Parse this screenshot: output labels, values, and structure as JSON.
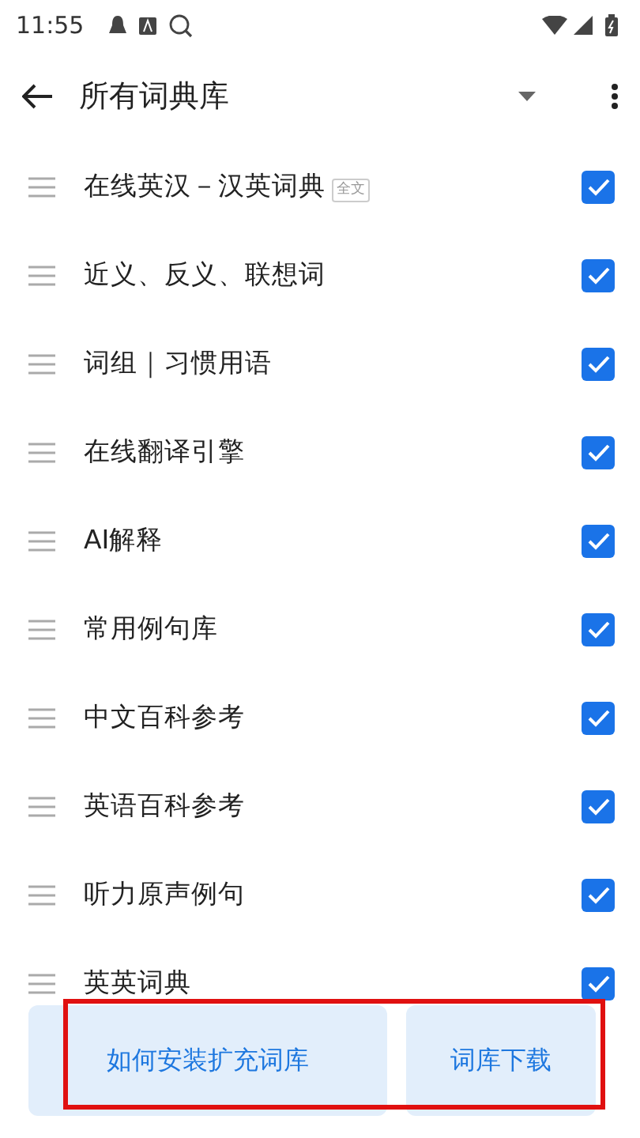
{
  "status_bar": {
    "time": "11:55"
  },
  "app_bar": {
    "title": "所有词典库"
  },
  "items": [
    {
      "label": "在线英汉－汉英词典",
      "tag": "全文",
      "checked": true
    },
    {
      "label": "近义、反义、联想词",
      "checked": true
    },
    {
      "label": "词组｜习惯用语",
      "checked": true
    },
    {
      "label": "在线翻译引擎",
      "checked": true
    },
    {
      "label": "AI解释",
      "checked": true
    },
    {
      "label": "常用例句库",
      "checked": true
    },
    {
      "label": "中文百科参考",
      "checked": true
    },
    {
      "label": "英语百科参考",
      "checked": true
    },
    {
      "label": "听力原声例句",
      "checked": true
    },
    {
      "label": "英英词典",
      "checked": true
    }
  ],
  "buttons": [
    "如何安装扩充词库",
    "词库下载"
  ]
}
